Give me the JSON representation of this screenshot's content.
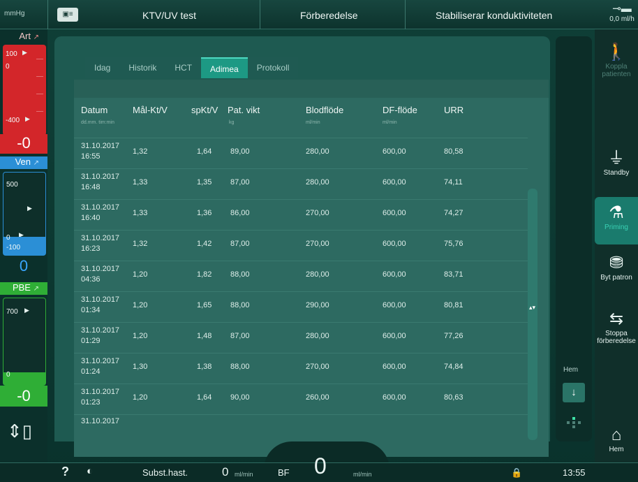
{
  "header": {
    "unit": "mmHg",
    "title": "KTV/UV test",
    "phase": "Förberedelse",
    "status": "Stabiliserar konduktiviteten",
    "flow_readout": "0,0 ml/h"
  },
  "pressures": {
    "art": {
      "label": "Art",
      "top_scale": "100",
      "zero_scale": "0",
      "bottom_scale": "-400",
      "value": "-0"
    },
    "ven": {
      "label": "Ven",
      "top_scale": "500",
      "zero_scale": "0",
      "bottom_scale": "-100",
      "value": "0"
    },
    "pbe": {
      "label": "PBE",
      "top_scale": "700",
      "zero_scale": "0",
      "value": "-0"
    }
  },
  "tabs": [
    {
      "label": "Idag"
    },
    {
      "label": "Historik"
    },
    {
      "label": "HCT"
    },
    {
      "label": "Adimea",
      "active": true
    },
    {
      "label": "Protokoll"
    }
  ],
  "table": {
    "columns": [
      {
        "label": "Datum",
        "sub": "dd.mm. tim:min"
      },
      {
        "label": "Mål-Kt/V",
        "sub": ""
      },
      {
        "label": "spKt/V",
        "sub": ""
      },
      {
        "label": "Pat. vikt",
        "sub": "kg"
      },
      {
        "label": "Blodflöde",
        "sub": "ml/min"
      },
      {
        "label": "DF-flöde",
        "sub": "ml/min"
      },
      {
        "label": "URR",
        "sub": ""
      }
    ],
    "rows": [
      {
        "date": "31.10.2017",
        "time": "16:55",
        "target": "1,32",
        "sp": "1,64",
        "weight": "89,00",
        "blood": "280,00",
        "df": "600,00",
        "urr": "80,58"
      },
      {
        "date": "31.10.2017",
        "time": "16:48",
        "target": "1,33",
        "sp": "1,35",
        "weight": "87,00",
        "blood": "280,00",
        "df": "600,00",
        "urr": "74,11"
      },
      {
        "date": "31.10.2017",
        "time": "16:40",
        "target": "1,33",
        "sp": "1,36",
        "weight": "86,00",
        "blood": "270,00",
        "df": "600,00",
        "urr": "74,27"
      },
      {
        "date": "31.10.2017",
        "time": "16:23",
        "target": "1,32",
        "sp": "1,42",
        "weight": "87,00",
        "blood": "270,00",
        "df": "600,00",
        "urr": "75,76"
      },
      {
        "date": "31.10.2017",
        "time": "04:36",
        "target": "1,20",
        "sp": "1,82",
        "weight": "88,00",
        "blood": "280,00",
        "df": "600,00",
        "urr": "83,71"
      },
      {
        "date": "31.10.2017",
        "time": "01:34",
        "target": "1,20",
        "sp": "1,65",
        "weight": "88,00",
        "blood": "290,00",
        "df": "600,00",
        "urr": "80,81"
      },
      {
        "date": "31.10.2017",
        "time": "01:29",
        "target": "1,20",
        "sp": "1,48",
        "weight": "87,00",
        "blood": "280,00",
        "df": "600,00",
        "urr": "77,26"
      },
      {
        "date": "31.10.2017",
        "time": "01:24",
        "target": "1,30",
        "sp": "1,38",
        "weight": "88,00",
        "blood": "270,00",
        "df": "600,00",
        "urr": "74,84"
      },
      {
        "date": "31.10.2017",
        "time": "01:23",
        "target": "1,20",
        "sp": "1,64",
        "weight": "90,00",
        "blood": "260,00",
        "df": "600,00",
        "urr": "80,63"
      }
    ],
    "partial_row_date": "31.10.2017"
  },
  "inner_nav": {
    "home_label": "Hem"
  },
  "sidebar": [
    {
      "label": "Koppla patienten",
      "icon": "patient-connect-icon",
      "disabled": true
    },
    {
      "label": "Standby",
      "icon": "standby-icon"
    },
    {
      "label": "Priming",
      "icon": "priming-icon",
      "active": true
    },
    {
      "label": "Byt patron",
      "icon": "cartridge-change-icon"
    },
    {
      "label": "Stoppa förberedelse",
      "icon": "stop-preparation-icon"
    },
    {
      "label": "Hem",
      "icon": "home-icon"
    }
  ],
  "bottom": {
    "help": "?",
    "subst_label": "Subst.hast.",
    "subst_value": "0",
    "subst_unit": "ml/min",
    "bf_label": "BF",
    "bf_value": "0",
    "bf_unit": "ml/min",
    "clock": "13:55"
  },
  "colors": {
    "art": "#d3262a",
    "ven": "#2b8fd6",
    "pbe": "#2fae36",
    "active_tab": "#1d9984"
  }
}
